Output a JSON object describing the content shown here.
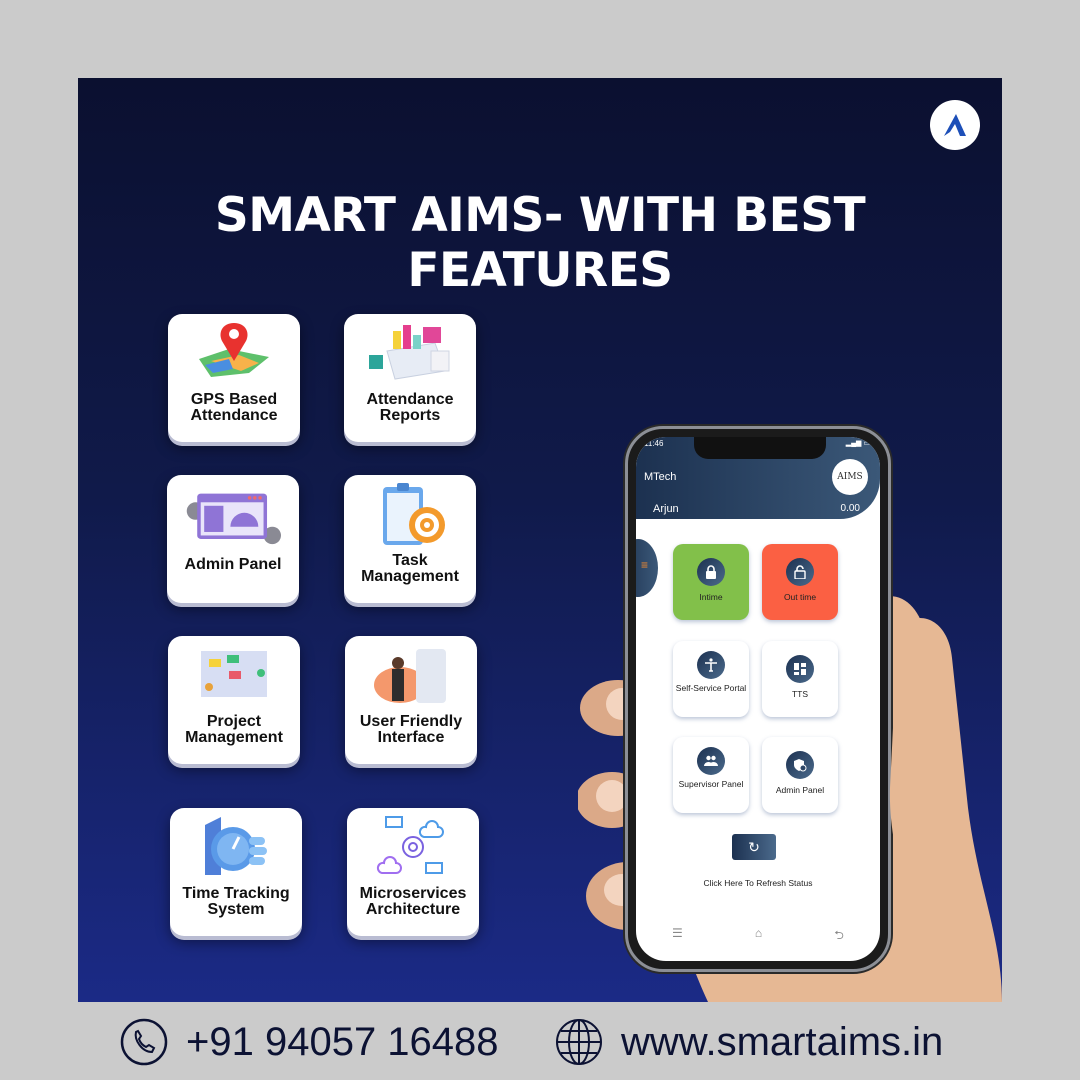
{
  "headline": "SMART AIMS- WITH BEST FEATURES",
  "brand": {
    "logo_icon": "aims-a-logo-icon",
    "accent": "#1d4fb8"
  },
  "features": [
    {
      "label_line1": "GPS Based",
      "label_line2": "Attendance",
      "icon": "map-pin-icon"
    },
    {
      "label_line1": "Attendance",
      "label_line2": "Reports",
      "icon": "report-chart-icon"
    },
    {
      "label_line1": "Admin Panel",
      "label_line2": "",
      "icon": "dashboard-gauge-icon"
    },
    {
      "label_line1": "Task",
      "label_line2": "Management",
      "icon": "checklist-target-icon"
    },
    {
      "label_line1": "Project",
      "label_line2": "Management",
      "icon": "team-board-icon"
    },
    {
      "label_line1": "User Friendly",
      "label_line2": "Interface",
      "icon": "user-phone-icon"
    },
    {
      "label_line1": "Time Tracking",
      "label_line2": "System",
      "icon": "stopwatch-hand-icon"
    },
    {
      "label_line1": "Microservices",
      "label_line2": "Architecture",
      "icon": "gear-cloud-server-icon"
    }
  ],
  "phone": {
    "status_time": "11:46",
    "company": "MTech",
    "app_logo": "AIMS",
    "user_name": "Arjun",
    "balance": "0.00",
    "tiles": [
      {
        "label": "Intime",
        "icon": "lock-icon",
        "color": "#82c04a"
      },
      {
        "label": "Out time",
        "icon": "unlock-icon",
        "color": "#fb6043"
      },
      {
        "label": "Self-Service Portal",
        "icon": "person-icon"
      },
      {
        "label": "TTS",
        "icon": "dashboard-grid-icon"
      },
      {
        "label": "Supervisor Panel",
        "icon": "group-icon"
      },
      {
        "label": "Admin Panel",
        "icon": "admin-shield-icon"
      }
    ],
    "refresh_label": "Click Here To Refresh Status"
  },
  "footer": {
    "phone": "+91 94057 16488",
    "website": "www.smartaims.in"
  }
}
